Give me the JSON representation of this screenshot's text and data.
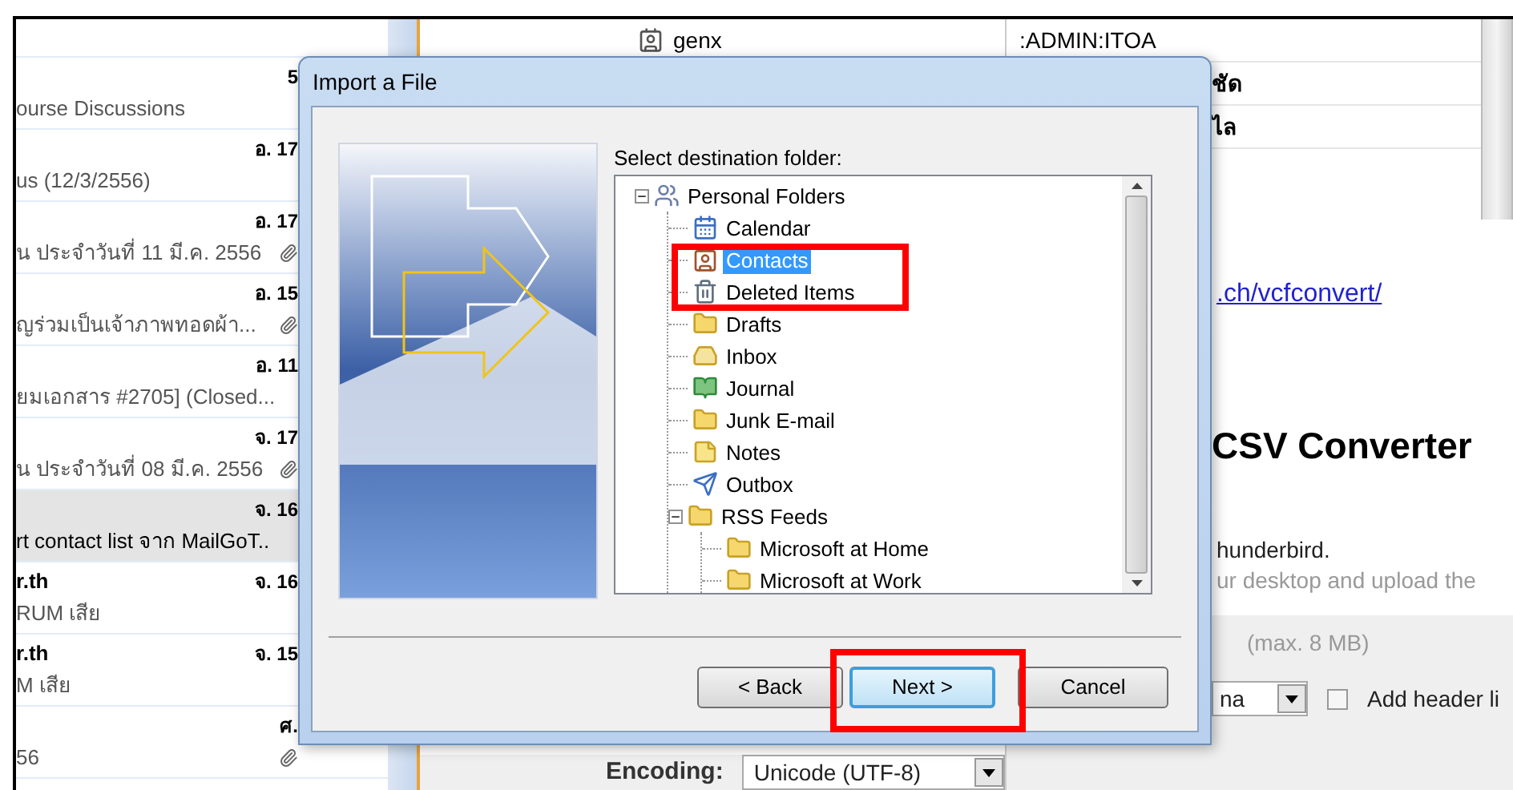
{
  "email_list": {
    "rows": [
      {
        "date": "5",
        "subject": "ourse Discussions",
        "attachment": false,
        "selected": false
      },
      {
        "date": "อ. 17",
        "subject": "us (12/3/2556)",
        "attachment": false,
        "selected": false
      },
      {
        "date": "อ. 17",
        "subject": "น ประจำวันที่ 11 มี.ค. 2556",
        "attachment": true,
        "selected": false
      },
      {
        "date": "อ. 15",
        "subject": "ญร่วมเป็นเจ้าภาพทอดผ้า...",
        "attachment": true,
        "selected": false
      },
      {
        "date": "อ. 11",
        "subject": "ยมเอกสาร #2705] (Closed...",
        "attachment": false,
        "selected": false
      },
      {
        "date": "จ. 17",
        "subject": "น ประจำวันที่ 08 มี.ค. 2556",
        "attachment": true,
        "selected": false
      },
      {
        "date": "จ. 16",
        "subject": "rt contact list จาก MailGoT..",
        "attachment": false,
        "selected": true
      },
      {
        "sender": "r.th",
        "date": "จ. 16",
        "subject": "RUM เสีย",
        "attachment": false,
        "selected": false
      },
      {
        "sender": "r.th",
        "date": "จ. 15",
        "subject": "M เสีย",
        "attachment": false,
        "selected": false
      },
      {
        "date": "ศ.",
        "subject": "56",
        "attachment": true,
        "selected": false
      }
    ]
  },
  "folder_pane": {
    "items": [
      {
        "label": "genx"
      }
    ]
  },
  "right_pane": {
    "rows": [
      ":ADMIN:ITOA",
      "ชัด",
      "ไล"
    ],
    "link": ".ch/vcfconvert/",
    "heading": "CSV Converter",
    "lines": [
      {
        "text": "hunderbird.",
        "muted": false
      },
      {
        "text": "ur desktop and upload the",
        "muted": true
      }
    ],
    "max_size": "(max. 8 MB)",
    "delimiter_select": "na",
    "header_checkbox": {
      "label": "Add header li",
      "checked": false
    }
  },
  "encoding": {
    "label": "Encoding:",
    "value": "Unicode (UTF-8)"
  },
  "dialog": {
    "title": "Import a File",
    "prompt": "Select destination folder:",
    "tree": [
      {
        "label": "Personal Folders",
        "kind": "root",
        "selected": false,
        "expanded": true,
        "children": [
          {
            "label": "Calendar",
            "kind": "calendar",
            "selected": false
          },
          {
            "label": "Contacts",
            "kind": "contacts",
            "selected": true
          },
          {
            "label": "Deleted Items",
            "kind": "trash",
            "selected": false
          },
          {
            "label": "Drafts",
            "kind": "folder",
            "selected": false
          },
          {
            "label": "Inbox",
            "kind": "inbox",
            "selected": false
          },
          {
            "label": "Journal",
            "kind": "journal",
            "selected": false
          },
          {
            "label": "Junk E-mail",
            "kind": "folder",
            "selected": false
          },
          {
            "label": "Notes",
            "kind": "notes",
            "selected": false
          },
          {
            "label": "Outbox",
            "kind": "outbox",
            "selected": false
          },
          {
            "label": "RSS Feeds",
            "kind": "folder",
            "selected": false,
            "expanded": true,
            "children": [
              {
                "label": "Microsoft at Home",
                "kind": "folder",
                "selected": false
              },
              {
                "label": "Microsoft at Work",
                "kind": "folder",
                "selected": false
              }
            ]
          }
        ]
      }
    ],
    "buttons": [
      {
        "label": "< Back",
        "default": false
      },
      {
        "label": "Next >",
        "default": true
      },
      {
        "label": "Cancel",
        "default": false
      }
    ]
  }
}
